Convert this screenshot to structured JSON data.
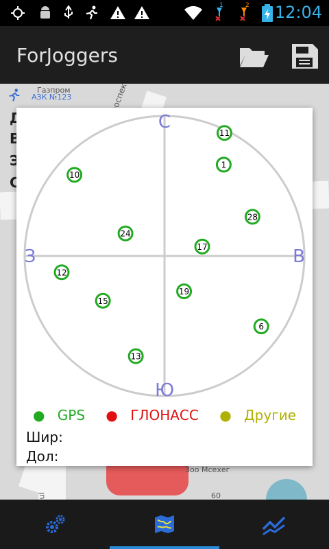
{
  "statusbar": {
    "time": "12:04",
    "left_icons": [
      "gps-icon",
      "android-icon",
      "usb-icon",
      "runner-icon",
      "warning-icon",
      "warning-icon"
    ],
    "right_icons": [
      "wifi-icon",
      "signal1-icon",
      "signal2-icon",
      "battery-icon"
    ],
    "sim1_label": "1",
    "sim2_label": "2"
  },
  "appbar": {
    "title": "ForJoggers",
    "open_icon": "folder-open-icon",
    "save_icon": "save-icon"
  },
  "map": {
    "labels": {
      "gazprom": "Газпром",
      "azs": "АЗК №123",
      "prospect": "проспект",
      "shop": "Зоо Мсехег",
      "num": "60",
      "road": "ul"
    },
    "side_letters": [
      "Д",
      "В",
      "Э",
      "С"
    ]
  },
  "skyplot": {
    "directions": {
      "north": "С",
      "south": "Ю",
      "west": "З",
      "east": "В"
    },
    "satellites": [
      {
        "id": "11",
        "az": 26,
        "el": 2,
        "type": "gps"
      },
      {
        "id": "1",
        "az": 33,
        "el": 20,
        "type": "gps"
      },
      {
        "id": "10",
        "az": 312,
        "el": 12,
        "type": "gps"
      },
      {
        "id": "28",
        "az": 66,
        "el": 28,
        "type": "gps"
      },
      {
        "id": "24",
        "az": 300,
        "el": 61,
        "type": "gps"
      },
      {
        "id": "17",
        "az": 76,
        "el": 65,
        "type": "gps"
      },
      {
        "id": "12",
        "az": 261,
        "el": 23,
        "type": "gps"
      },
      {
        "id": "19",
        "az": 151,
        "el": 64,
        "type": "gps"
      },
      {
        "id": "15",
        "az": 234,
        "el": 41,
        "type": "gps"
      },
      {
        "id": "13",
        "az": 196,
        "el": 23,
        "type": "gps"
      },
      {
        "id": "6",
        "az": 126,
        "el": 13,
        "type": "gps"
      }
    ]
  },
  "legend": {
    "gps": "GPS",
    "glonass": "ГЛОНАСС",
    "other": "Другие",
    "colors": {
      "gps": "#22aa22",
      "glonass": "#e01010",
      "other": "#b0b000"
    }
  },
  "coords": {
    "lat_label": "Шир:",
    "lon_label": "Дол:"
  },
  "bottombar": {
    "tabs": [
      "settings-icon",
      "map-icon",
      "chart-icon"
    ],
    "selected": 1
  }
}
